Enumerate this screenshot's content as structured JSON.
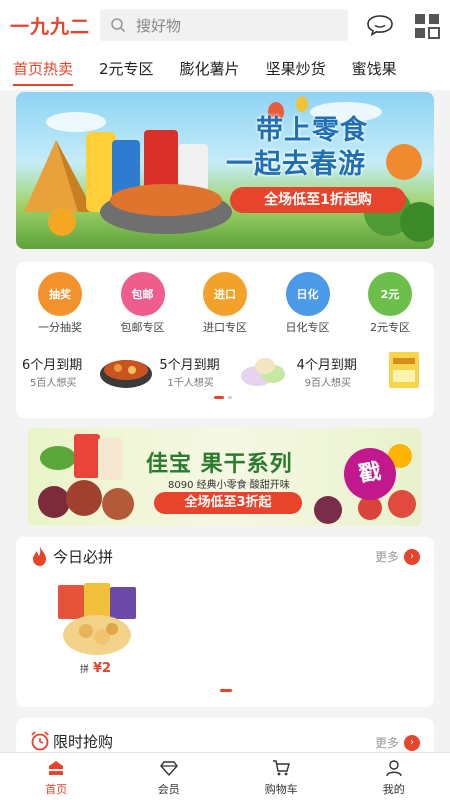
{
  "header": {
    "logo": "一九九二",
    "search_placeholder": "搜好物"
  },
  "tabs": [
    {
      "label": "首页热卖",
      "active": true
    },
    {
      "label": "2元专区"
    },
    {
      "label": "膨化薯片"
    },
    {
      "label": "坚果炒货"
    },
    {
      "label": "蜜饯果"
    }
  ],
  "banner1": {
    "line1": "带上零食",
    "line2": "一起去春游",
    "promo": "全场低至1折起购"
  },
  "categories": [
    {
      "icon_text": "抽奖",
      "label": "一分抽奖",
      "icon": "lottery-icon",
      "color": "#f3922c"
    },
    {
      "icon_text": "包邮",
      "label": "包邮专区",
      "icon": "free-shipping-icon",
      "color": "#ee5d8c"
    },
    {
      "icon_text": "进口",
      "label": "进口专区",
      "icon": "import-icon",
      "color": "#f2a22b"
    },
    {
      "icon_text": "日化",
      "label": "日化专区",
      "icon": "daily-chemical-icon",
      "color": "#4a9ae8"
    },
    {
      "icon_text": "2元",
      "label": "2元专区",
      "icon": "two-yuan-icon",
      "color": "#6cbf4a"
    }
  ],
  "expiring": [
    {
      "title": "6个月到期",
      "sub": "5百人想买"
    },
    {
      "title": "5个月到期",
      "sub": "1千人想买"
    },
    {
      "title": "4个月到期",
      "sub": "9百人想买"
    }
  ],
  "banner2": {
    "title": "佳宝 果干系列",
    "sub": "8090 经典小零食 酸甜开味",
    "promo": "全场低至3折起",
    "stamp": "戳"
  },
  "today": {
    "title": "今日必拼",
    "more": "更多",
    "product": {
      "tag": "拼",
      "price": "¥2"
    }
  },
  "flash": {
    "title": "限时抢购",
    "more": "更多"
  },
  "bottom_nav": [
    {
      "label": "首页",
      "active": true
    },
    {
      "label": "会员"
    },
    {
      "label": "购物车"
    },
    {
      "label": "我的"
    }
  ],
  "colors": {
    "accent": "#e8432b"
  }
}
